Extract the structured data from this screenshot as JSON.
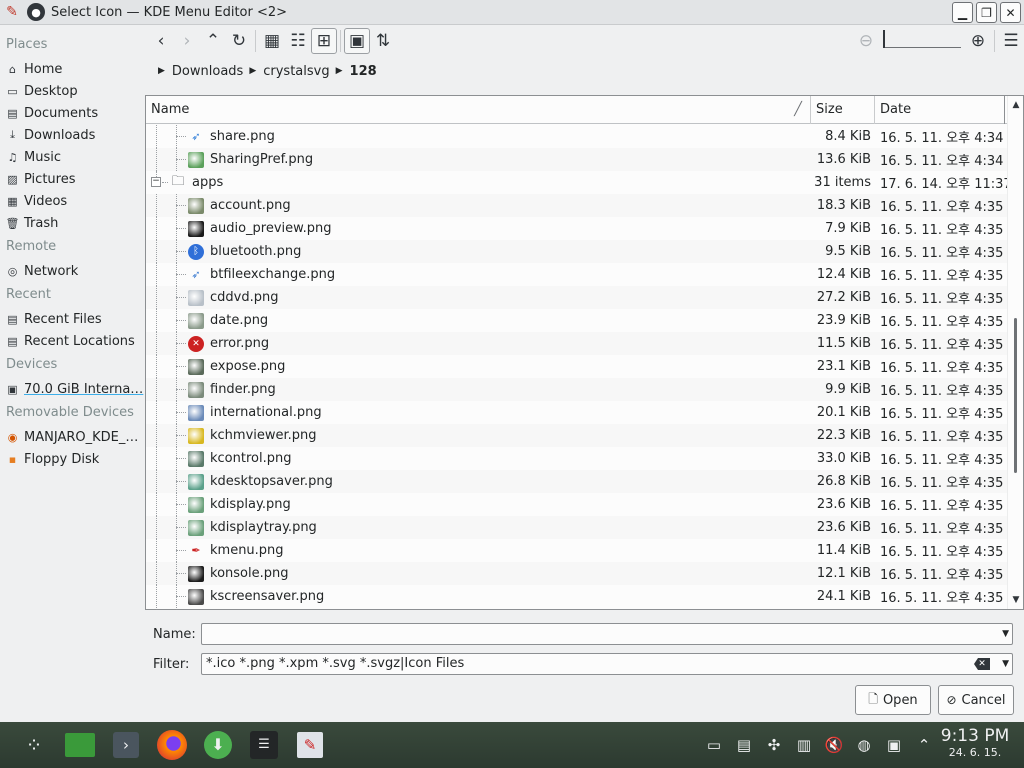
{
  "window": {
    "title": "Select Icon — KDE Menu Editor <2>"
  },
  "sidebar": {
    "sections": [
      {
        "label": "Places",
        "items": [
          {
            "label": "Home",
            "icon": "home-icon"
          },
          {
            "label": "Desktop",
            "icon": "desktop-icon"
          },
          {
            "label": "Documents",
            "icon": "documents-icon"
          },
          {
            "label": "Downloads",
            "icon": "downloads-icon"
          },
          {
            "label": "Music",
            "icon": "music-icon"
          },
          {
            "label": "Pictures",
            "icon": "pictures-icon"
          },
          {
            "label": "Videos",
            "icon": "videos-icon"
          },
          {
            "label": "Trash",
            "icon": "trash-icon"
          }
        ]
      },
      {
        "label": "Remote",
        "items": [
          {
            "label": "Network",
            "icon": "network-icon"
          }
        ]
      },
      {
        "label": "Recent",
        "items": [
          {
            "label": "Recent Files",
            "icon": "recent-files-icon"
          },
          {
            "label": "Recent Locations",
            "icon": "recent-locations-icon"
          }
        ]
      },
      {
        "label": "Devices",
        "items": [
          {
            "label": "70.0 GiB Interna…",
            "icon": "hard-disk-icon"
          }
        ]
      },
      {
        "label": "Removable Devices",
        "items": [
          {
            "label": "MANJARO_KDE_…",
            "icon": "optical-disc-icon"
          },
          {
            "label": "Floppy Disk",
            "icon": "floppy-icon"
          }
        ]
      }
    ]
  },
  "breadcrumb": [
    "Downloads",
    "crystalsvg",
    "128"
  ],
  "table": {
    "columns": {
      "name": "Name",
      "size": "Size",
      "date": "Date"
    },
    "rows": [
      {
        "name": "share.png",
        "size": "8.4 KiB",
        "date": "16. 5. 11. 오후 4:34",
        "icon": "share-icon",
        "color": "#2f7dd8"
      },
      {
        "name": "SharingPref.png",
        "size": "13.6 KiB",
        "date": "16. 5. 11. 오후 4:34",
        "icon": "sharing-pref-icon",
        "color": "#5aa05a"
      },
      {
        "name": "apps",
        "size": "31 items",
        "date": "17. 6. 14. 오후 11:37",
        "icon": "folder-icon",
        "color": "#31363b"
      },
      {
        "name": "account.png",
        "size": "18.3 KiB",
        "date": "16. 5. 11. 오후 4:35",
        "icon": "account-icon",
        "color": "#7a8a6a"
      },
      {
        "name": "audio_preview.png",
        "size": "7.9 KiB",
        "date": "16. 5. 11. 오후 4:35",
        "icon": "audio-preview-icon",
        "color": "#1b1b1b"
      },
      {
        "name": "bluetooth.png",
        "size": "9.5 KiB",
        "date": "16. 5. 11. 오후 4:35",
        "icon": "bluetooth-icon",
        "color": "#2f6fd8"
      },
      {
        "name": "btfileexchange.png",
        "size": "12.4 KiB",
        "date": "16. 5. 11. 오후 4:35",
        "icon": "btfileexchange-icon",
        "color": "#3a7ad0"
      },
      {
        "name": "cddvd.png",
        "size": "27.2 KiB",
        "date": "16. 5. 11. 오후 4:35",
        "icon": "cddvd-icon",
        "color": "#b8c0c8"
      },
      {
        "name": "date.png",
        "size": "23.9 KiB",
        "date": "16. 5. 11. 오후 4:35",
        "icon": "date-icon",
        "color": "#8a9a8a"
      },
      {
        "name": "error.png",
        "size": "11.5 KiB",
        "date": "16. 5. 11. 오후 4:35",
        "icon": "error-icon",
        "color": "#cc2222"
      },
      {
        "name": "expose.png",
        "size": "23.1 KiB",
        "date": "16. 5. 11. 오후 4:35",
        "icon": "expose-icon",
        "color": "#5a6a5a"
      },
      {
        "name": "finder.png",
        "size": "9.9 KiB",
        "date": "16. 5. 11. 오후 4:35",
        "icon": "finder-icon",
        "color": "#7a8a7a"
      },
      {
        "name": "international.png",
        "size": "20.1 KiB",
        "date": "16. 5. 11. 오후 4:35",
        "icon": "international-icon",
        "color": "#6a8ab8"
      },
      {
        "name": "kchmviewer.png",
        "size": "22.3 KiB",
        "date": "16. 5. 11. 오후 4:35",
        "icon": "kchmviewer-icon",
        "color": "#d8b820"
      },
      {
        "name": "kcontrol.png",
        "size": "33.0 KiB",
        "date": "16. 5. 11. 오후 4:35",
        "icon": "kcontrol-icon",
        "color": "#5a7a6a"
      },
      {
        "name": "kdesktopsaver.png",
        "size": "26.8 KiB",
        "date": "16. 5. 11. 오후 4:35",
        "icon": "kdesktopsaver-icon",
        "color": "#5aa08a"
      },
      {
        "name": "kdisplay.png",
        "size": "23.6 KiB",
        "date": "16. 5. 11. 오후 4:35",
        "icon": "kdisplay-icon",
        "color": "#6aa07a"
      },
      {
        "name": "kdisplaytray.png",
        "size": "23.6 KiB",
        "date": "16. 5. 11. 오후 4:35",
        "icon": "kdisplaytray-icon",
        "color": "#6aa07a"
      },
      {
        "name": "kmenu.png",
        "size": "11.4 KiB",
        "date": "16. 5. 11. 오후 4:35",
        "icon": "kmenu-icon",
        "color": "#cc2222"
      },
      {
        "name": "konsole.png",
        "size": "12.1 KiB",
        "date": "16. 5. 11. 오후 4:35",
        "icon": "konsole-icon",
        "color": "#1b1b1b"
      },
      {
        "name": "kscreensaver.png",
        "size": "24.1 KiB",
        "date": "16. 5. 11. 오후 4:35",
        "icon": "kscreensaver-icon",
        "color": "#4a4a4a"
      }
    ]
  },
  "name_field": {
    "label": "Name:",
    "value": ""
  },
  "filter_field": {
    "label": "Filter:",
    "value": "*.ico *.png *.xpm *.svg *.svgz|Icon Files"
  },
  "buttons": {
    "open": "Open",
    "cancel": "Cancel"
  },
  "clock": {
    "time": "9:13 PM",
    "date": "24. 6. 15."
  },
  "colors": {
    "accent": "#3daee9",
    "window_bg": "#eff0f1",
    "view_bg": "#fcfcfc",
    "taskbar": "#2f3d33"
  }
}
